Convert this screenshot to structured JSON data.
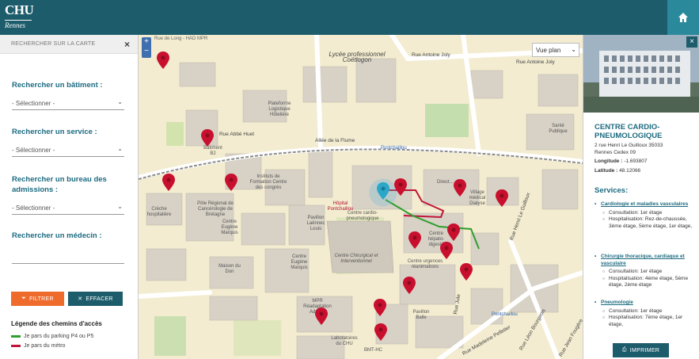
{
  "header": {
    "logo_text": "CHU",
    "logo_sub": "Rennes",
    "home_icon": "home-icon"
  },
  "sidebar": {
    "title": "RECHERCHER SUR LA CARTE",
    "close": "×",
    "building": {
      "label": "Rechercher un bâtiment :",
      "value": "- Sélectionner -"
    },
    "service": {
      "label": "Rechercher un service :",
      "value": "- Sélectionner -"
    },
    "admissions": {
      "label": "Rechercher un bureau des admissions :",
      "value": "- Sélectionner -"
    },
    "doctor": {
      "label": "Rechercher un médecin :",
      "value": ""
    },
    "filter_button": "FILTRER",
    "clear_button": "EFFACER",
    "legend": {
      "title": "Légende des chemins d'accès",
      "items": [
        {
          "label": "Je pars du parking P4 ou P5",
          "color": "#2e9e2e"
        },
        {
          "label": "Je pars du métro",
          "color": "#c0163a"
        }
      ]
    }
  },
  "map": {
    "view_select": "Vue plan",
    "zoom_in": "+",
    "zoom_out": "−",
    "credit": "Rue de Long - HAD MPR",
    "labels": {
      "lycee": "Lycée professionnel Coëtlogon",
      "rue_joly": "Rue Antoine Joly",
      "rue_joly2": "Rue Antoine Joly",
      "plateforme": "Plateforme Logistique Hôtelière",
      "sante": "Santé Publique",
      "allee_flume": "Allée de la Flume",
      "pontchaillou_metro": "Pontchaillou",
      "rue_huet": "Rue Abbé Huet",
      "batiment_b2": "Bâtiment B2",
      "instituts": "Instituts de Formation Centre des congrès",
      "pole": "Pôle Régional de Cancérologie de Bretagne",
      "creche": "Crèche hospitalière",
      "hopital": "Hôpital Pontchaillou",
      "pavillon_laennec": "Pavillon Laënnec Louis",
      "centre_cardio": "Centre cardio-pneumologique",
      "direct": "Direct...",
      "village": "Village médical Dialyse",
      "eugene_marquis": "Centre Eugène Marquis",
      "eugene_marquis2": "Centre Eugène Marquis",
      "maison_don": "Maison du Don",
      "chirurgical": "Centre Chirurgical et Interventionnel",
      "hepato": "Centre hépato-digestif",
      "urgences": "Centre urgences réanimations",
      "guilloux": "Rue Henri Le Guilloux",
      "rue_jule": "Rue Jule",
      "mpr": "MPR Réadaptation Adultes",
      "pavillon_balle": "Pavillon Balle",
      "labo": "Laboratoires du CHU",
      "bmt": "BMT-HC",
      "pellerin": "Rue Madeleine Pelletier",
      "pontchaillou_bottom": "Pontchaillou",
      "leon_bourgeois": "Rue Léon Bourgeois",
      "fougeres": "Rue Jean Fougère"
    }
  },
  "panel": {
    "close": "×",
    "title": "CENTRE CARDIO-PNEUMOLOGIQUE",
    "address_line1": "2 rue Henri Le Guilloux 35033",
    "address_line2": "Rennes Cedex 09",
    "longitude_label": "Longitude :",
    "longitude": "-1.693807",
    "latitude_label": "Latitude :",
    "latitude": "48.12066",
    "services_title": "Services:",
    "services": [
      {
        "name": "Cardiologie et maladies vasculaires",
        "lines": [
          "Consultation: 1er étage",
          "Hospitalisation: Rez-de-chaussée, 3ème étage, 5ème étage, 1er étage,"
        ]
      },
      {
        "name": "Chirurgie thoracique, cardiaque et vasculaire",
        "lines": [
          "Consultation: 1er étage",
          "Hospitalisation: 4ème étage, 5ème étage, 2ème étage"
        ]
      },
      {
        "name": "Pneumologie",
        "lines": [
          "Consultation: 1er étage",
          "Hospitalisation: 7ème étage, 1er étage,"
        ]
      }
    ],
    "print_button": "IMPRIMER"
  },
  "colors": {
    "header": "#1d5c6b",
    "accent": "#1d6b80",
    "filter": "#ee6b2c",
    "pin": "#c8102e",
    "selected_pin": "#2aa7c9"
  }
}
